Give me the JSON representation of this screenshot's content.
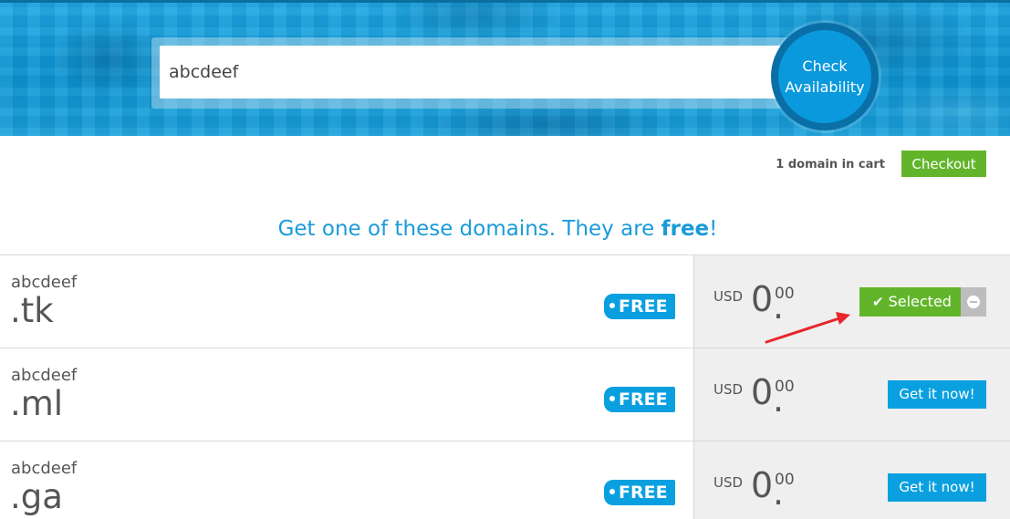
{
  "search": {
    "value": "abcdeef",
    "button_label_line1": "Check",
    "button_label_line2": "Availability"
  },
  "cart": {
    "count_text": "1 domain in cart",
    "checkout_label": "Checkout"
  },
  "headline": {
    "prefix": "Get one of these domains. They are ",
    "emphasis": "free",
    "suffix": "!"
  },
  "domains": [
    {
      "sld": "abcdeef",
      "tld": ".tk",
      "badge": "FREE",
      "currency": "USD",
      "price_int": "0",
      "price_dec": "00",
      "state": "selected",
      "action_label": "Selected"
    },
    {
      "sld": "abcdeef",
      "tld": ".ml",
      "badge": "FREE",
      "currency": "USD",
      "price_int": "0",
      "price_dec": "00",
      "state": "available",
      "action_label": "Get it now!"
    },
    {
      "sld": "abcdeef",
      "tld": ".ga",
      "badge": "FREE",
      "currency": "USD",
      "price_int": "0",
      "price_dec": "00",
      "state": "available",
      "action_label": "Get it now!"
    }
  ],
  "icons": {
    "selected": "check-icon",
    "remove": "minus-circle-icon",
    "badge_dot": "dot-icon"
  },
  "colors": {
    "brand_blue": "#0aa0e0",
    "success_green": "#62b52b",
    "annotation_red": "#e8262b"
  }
}
